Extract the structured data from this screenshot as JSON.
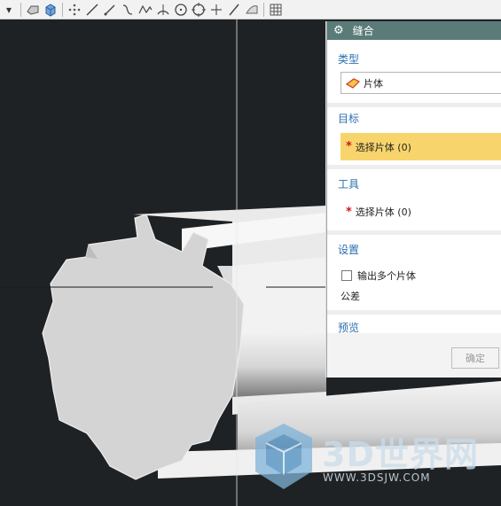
{
  "toolbar": {
    "icons": [
      "dropdown-arrow-icon",
      "shaded-block-icon",
      "cube-icon",
      "point-set-icon",
      "line-icon",
      "line-icon",
      "spline-icon",
      "studio-spline-icon",
      "arc-icon",
      "circle-icon",
      "circle-center-icon",
      "cross-point-icon",
      "line-icon",
      "curve-feature-icon",
      "table-grid-icon"
    ]
  },
  "panel": {
    "title": "缝合",
    "type_section": {
      "heading": "类型",
      "value": "片体"
    },
    "target_section": {
      "heading": "目标",
      "selection_label": "选择片体 (0)"
    },
    "tool_section": {
      "heading": "工具",
      "selection_label": "选择片体 (0)"
    },
    "settings_section": {
      "heading": "设置",
      "checkbox_label": "输出多个片体",
      "checkbox_checked": false,
      "tolerance_label": "公差"
    },
    "preview_section": {
      "heading": "预览"
    },
    "ok_button": "确定"
  },
  "watermark": {
    "brand": "3D世界网",
    "url": "WWW.3DSJW.COM"
  },
  "colors": {
    "title_bar": "#5b7b78",
    "section_heading": "#2c6fb0",
    "selection_highlight": "#f8d56c",
    "viewport_bg": "#1f2224"
  }
}
